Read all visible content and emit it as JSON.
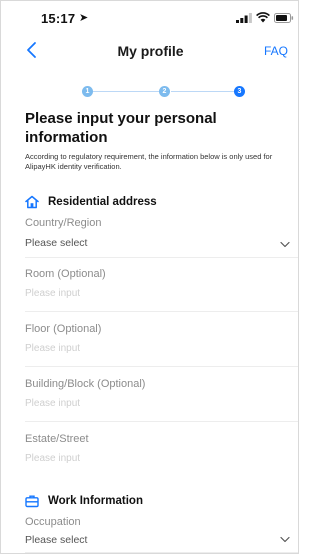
{
  "status_bar": {
    "time": "15:17",
    "location_arrow": "➤"
  },
  "nav": {
    "title": "My profile",
    "faq_label": "FAQ"
  },
  "stepper": {
    "steps": [
      "1",
      "2",
      "3"
    ],
    "current_step": 3
  },
  "heading": "Please input your personal information",
  "notice": "According to regulatory requirement, the information below is only used for AlipayHK identity verification.",
  "residential": {
    "title": "Residential address",
    "icon": "home-icon",
    "fields": [
      {
        "label": "Country/Region",
        "value": "Please select",
        "type": "select"
      },
      {
        "label": "Room (Optional)",
        "placeholder": "Please input",
        "type": "input"
      },
      {
        "label": "Floor (Optional)",
        "placeholder": "Please input",
        "type": "input"
      },
      {
        "label": "Building/Block (Optional)",
        "placeholder": "Please input",
        "type": "input"
      },
      {
        "label": "Estate/Street",
        "placeholder": "Please input",
        "type": "input"
      }
    ]
  },
  "work": {
    "title": "Work Information",
    "icon": "briefcase-icon",
    "fields": [
      {
        "label": "Occupation",
        "value": "Please select",
        "type": "select"
      }
    ]
  },
  "colors": {
    "accent": "#1677ff",
    "step_inactive": "#7dbbee"
  }
}
